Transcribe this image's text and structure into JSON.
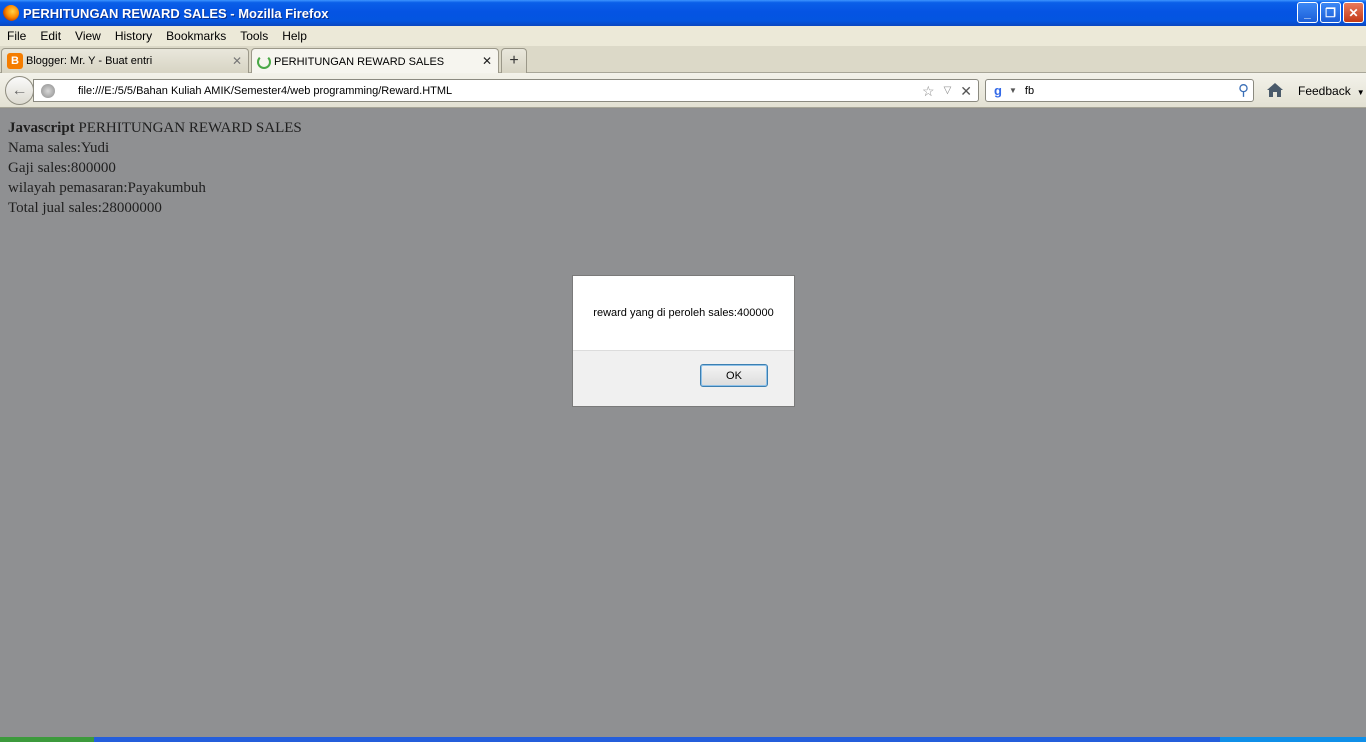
{
  "window": {
    "title": "PERHITUNGAN REWARD SALES - Mozilla Firefox",
    "minimize_glyph": "_",
    "restore_glyph": "❐",
    "close_glyph": "✕"
  },
  "menu": {
    "file": "File",
    "edit": "Edit",
    "view": "View",
    "history": "History",
    "bookmarks": "Bookmarks",
    "tools": "Tools",
    "help": "Help"
  },
  "tabs": [
    {
      "label": "Blogger: Mr. Y - Buat entri",
      "icon": "blogger-icon",
      "active": false
    },
    {
      "label": "PERHITUNGAN REWARD SALES",
      "icon": "loading-spinner-icon",
      "active": true
    }
  ],
  "tab_close_glyph": "✕",
  "new_tab_glyph": "+",
  "nav": {
    "url": "file:///E:/5/5/Bahan Kuliah AMIK/Semester4/web programming/Reward.HTML",
    "search_value": "fb",
    "feedback": "Feedback"
  },
  "page": {
    "heading_bold": "Javascript",
    "heading_rest": " PERHITUNGAN REWARD SALES",
    "nama": "Nama sales:Yudi",
    "gaji": "Gaji sales:800000",
    "wilayah": "wilayah pemasaran:Payakumbuh",
    "total": "Total jual sales:28000000"
  },
  "dialog": {
    "message": "reward yang di peroleh sales:400000",
    "ok": "OK"
  }
}
